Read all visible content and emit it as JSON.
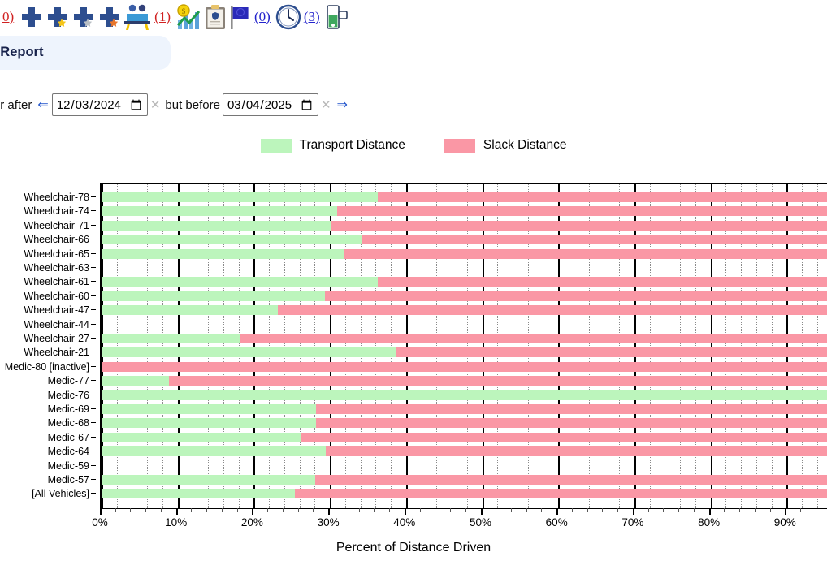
{
  "toolbar": {
    "items": [
      {
        "icon": "cross-plain-icon",
        "name": "add-plain",
        "count": null,
        "count_color": "red"
      },
      {
        "icon": "cross-gold-star-icon",
        "name": "add-gold-star",
        "count": null,
        "count_color": null
      },
      {
        "icon": "cross-silver-star-icon",
        "name": "add-silver-star",
        "count": null,
        "count_color": null
      },
      {
        "icon": "cross-bronze-star-icon",
        "name": "add-bronze-star",
        "count": null,
        "count_color": null
      },
      {
        "icon": "crew-pair-icon",
        "name": "crew",
        "count": "(1)",
        "count_color": "red"
      },
      {
        "icon": "finance-chart-icon",
        "name": "finance-report",
        "count": null,
        "count_color": null
      },
      {
        "icon": "clipboard-icon",
        "name": "clipboard",
        "count": null,
        "count_color": null
      },
      {
        "icon": "flag-icon",
        "name": "flagged",
        "count": "(0)",
        "count_color": "blue"
      },
      {
        "icon": "clock-icon",
        "name": "pending",
        "count": "(3)",
        "count_color": "blue"
      },
      {
        "icon": "battery-icon",
        "name": "battery",
        "count": null,
        "count_color": null
      }
    ],
    "leading_count": "0)",
    "leading_count_color": "red"
  },
  "tab": {
    "label": "e Efficiency Report",
    "background": "#eef4fd",
    "text_color": "#17224b"
  },
  "filter": {
    "prefix_text": "tches on or after",
    "back_arrow": "⇐",
    "start_date": "12/03/2024",
    "start_clear": "✕",
    "middle_text": "but before",
    "end_date": "03/04/2025",
    "end_clear": "✕",
    "forward_arrow": "⇒"
  },
  "legend": [
    {
      "label": "Transport Distance",
      "color": "#bcf5bc"
    },
    {
      "label": "Slack Distance",
      "color": "#fa97a5"
    }
  ],
  "chart_data": {
    "type": "bar",
    "orientation": "horizontal",
    "stacked": true,
    "title": "",
    "xlabel": "Percent of Distance Driven",
    "ylabel": "",
    "xlim": [
      0,
      95.5
    ],
    "xticks": [
      0,
      10,
      20,
      30,
      40,
      50,
      60,
      70,
      80,
      90
    ],
    "xticklabels": [
      "0%",
      "10%",
      "20%",
      "30%",
      "40%",
      "50%",
      "60%",
      "70%",
      "80%",
      "90%"
    ],
    "grid": true,
    "legend_position": "top-center",
    "categories": [
      "Wheelchair-78",
      "Wheelchair-74",
      "Wheelchair-71",
      "Wheelchair-66",
      "Wheelchair-65",
      "Wheelchair-63",
      "Wheelchair-61",
      "Wheelchair-60",
      "Wheelchair-47",
      "Wheelchair-44",
      "Wheelchair-27",
      "Wheelchair-21",
      "Medic-80 [inactive]",
      "Medic-77",
      "Medic-76",
      "Medic-69",
      "Medic-68",
      "Medic-67",
      "Medic-64",
      "Medic-59",
      "Medic-57",
      "[All Vehicles]"
    ],
    "series": [
      {
        "name": "Transport Distance",
        "color": "#bcf5bc",
        "values": [
          36.3,
          31.0,
          30.2,
          34.2,
          31.8,
          0,
          36.3,
          29.3,
          23.2,
          0,
          18.3,
          38.7,
          0,
          8.9,
          100,
          28.2,
          28.2,
          26.3,
          29.5,
          0,
          28.1,
          25.4
        ]
      },
      {
        "name": "Slack Distance",
        "color": "#fa97a5",
        "values": [
          63.7,
          69.0,
          69.8,
          65.8,
          68.2,
          0,
          63.7,
          70.7,
          76.8,
          0,
          81.7,
          61.3,
          100,
          91.1,
          0,
          71.8,
          71.8,
          73.7,
          70.5,
          0,
          71.9,
          74.6
        ]
      }
    ]
  }
}
